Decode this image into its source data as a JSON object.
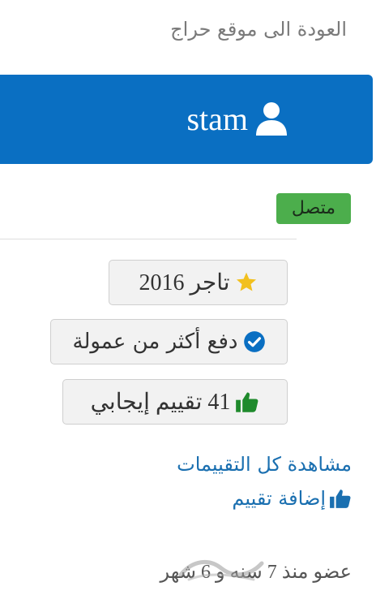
{
  "nav": {
    "back_link": "العودة الى موقع حراج"
  },
  "profile": {
    "username": "stam",
    "user_icon": "user-icon",
    "header_color": "#0a6fc2",
    "status": "متصل",
    "status_color": "#4cae4c"
  },
  "badges": [
    {
      "icon": "star-icon",
      "text": "تاجر 2016"
    },
    {
      "icon": "check-circle-icon",
      "text": "دفع أكثر من عمولة"
    },
    {
      "icon": "thumbs-up-icon",
      "text": "41 تقييم إيجابي"
    }
  ],
  "links": {
    "view_all_ratings": "مشاهدة كل التقييمات",
    "add_rating": "إضافة تقييم",
    "link_color": "#1a6fb0"
  },
  "membership": {
    "text": "عضو منذ 7 سنه و 6 شهر"
  }
}
